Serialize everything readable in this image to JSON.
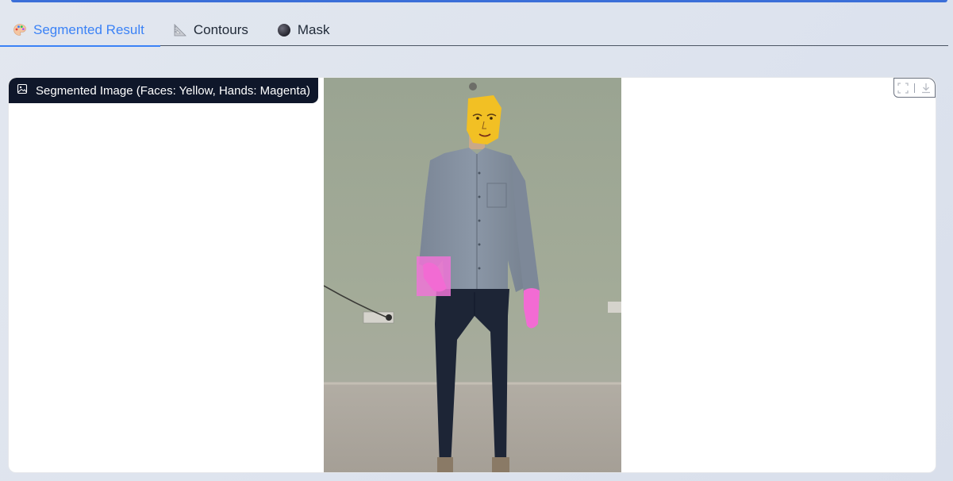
{
  "tabs": [
    {
      "label": "Segmented Result",
      "icon": "palette-icon",
      "active": true
    },
    {
      "label": "Contours",
      "icon": "triangular-ruler-icon",
      "active": false
    },
    {
      "label": "Mask",
      "icon": "dark-circle-icon",
      "active": false
    }
  ],
  "panel": {
    "label": "Segmented Image (Faces: Yellow, Hands: Magenta)",
    "label_icon": "image-icon",
    "toolbar": [
      {
        "icon": "fullscreen-icon"
      },
      {
        "icon": "download-icon"
      }
    ]
  },
  "colors": {
    "accent": "#3b82f6",
    "face_overlay": "#f2c024",
    "hand_overlay": "#f26bd3",
    "badge_bg": "#0f172a"
  }
}
